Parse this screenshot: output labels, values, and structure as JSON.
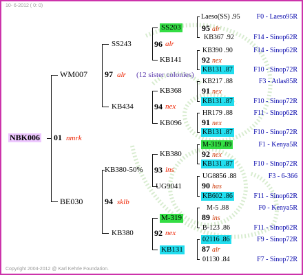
{
  "header": {
    "date": "10- 6-2012 ( 0: 0)"
  },
  "footer": {
    "copyright": "Copyright 2004-2012 @ Karl Kehrle Foundation."
  },
  "root": {
    "name": "NBK006",
    "num": "01",
    "mark": "nmrk"
  },
  "gen1": [
    {
      "name": "WM007",
      "num": "97",
      "mark": "alr",
      "note": "(12 sister colonies)"
    },
    {
      "name": "BE030",
      "num": "94",
      "mark": "sklb"
    }
  ],
  "gen2": [
    {
      "name": "SS243",
      "num": "96",
      "mark": "alr"
    },
    {
      "name": "KB434",
      "num": "94",
      "mark": "nex"
    },
    {
      "name": "KB380-50%",
      "num": "93",
      "mark": "ins"
    },
    {
      "name": "KB380",
      "num": "92",
      "mark": "nex"
    }
  ],
  "gen3": [
    {
      "name": "SS203",
      "num": "95",
      "mark": "alr"
    },
    {
      "name": "KB141",
      "num": "92",
      "mark": "nex"
    },
    {
      "name": "KB368",
      "num": "91",
      "mark": "nex"
    },
    {
      "name": "KB096",
      "num": "91",
      "mark": "nex"
    },
    {
      "name": "KB380",
      "num": "92",
      "mark": "nex"
    },
    {
      "name": "UG9041",
      "num": "90",
      "mark": "has"
    },
    {
      "name": "M-319",
      "num": "89",
      "mark": "ins"
    },
    {
      "name": "KB131",
      "num": "87",
      "mark": "alr"
    }
  ],
  "gen4": [
    {
      "name": "Laeso(SS) .95",
      "line": "F0 - Laeso95R"
    },
    {
      "name": "KB367 .92",
      "line": "F14 - Sinop62R"
    },
    {
      "name": "KB390 .90",
      "line": "F14 - Sinop62R"
    },
    {
      "name": "KB131 .87",
      "line": "F10 - Sinop72R"
    },
    {
      "name": "KB217 .88",
      "line": "F3 - Atlas85R"
    },
    {
      "name": "KB131 .87",
      "line": "F10 - Sinop72R"
    },
    {
      "name": "HR179 .88",
      "line": "F11 - Sinop62R"
    },
    {
      "name": "KB131 .87",
      "line": "F10 - Sinop72R"
    },
    {
      "name": "M-319 .89",
      "line": "F1 - Kenya5R"
    },
    {
      "name": "KB131 .87",
      "line": "F10 - Sinop72R"
    },
    {
      "name": "UG8856 .88",
      "line": "F3 - 6-366"
    },
    {
      "name": "KB602 .86",
      "line": "F11 - Sinop62R"
    },
    {
      "name": "M-5 .88",
      "line": "F0 - Kenya5R"
    },
    {
      "name": "B-123 .86",
      "line": "F11 - Sinop62R"
    },
    {
      "name": "02116 .86",
      "line": "F9 - Sinop72R"
    },
    {
      "name": "01130 .84",
      "line": "F7 - Sinop72R"
    }
  ]
}
